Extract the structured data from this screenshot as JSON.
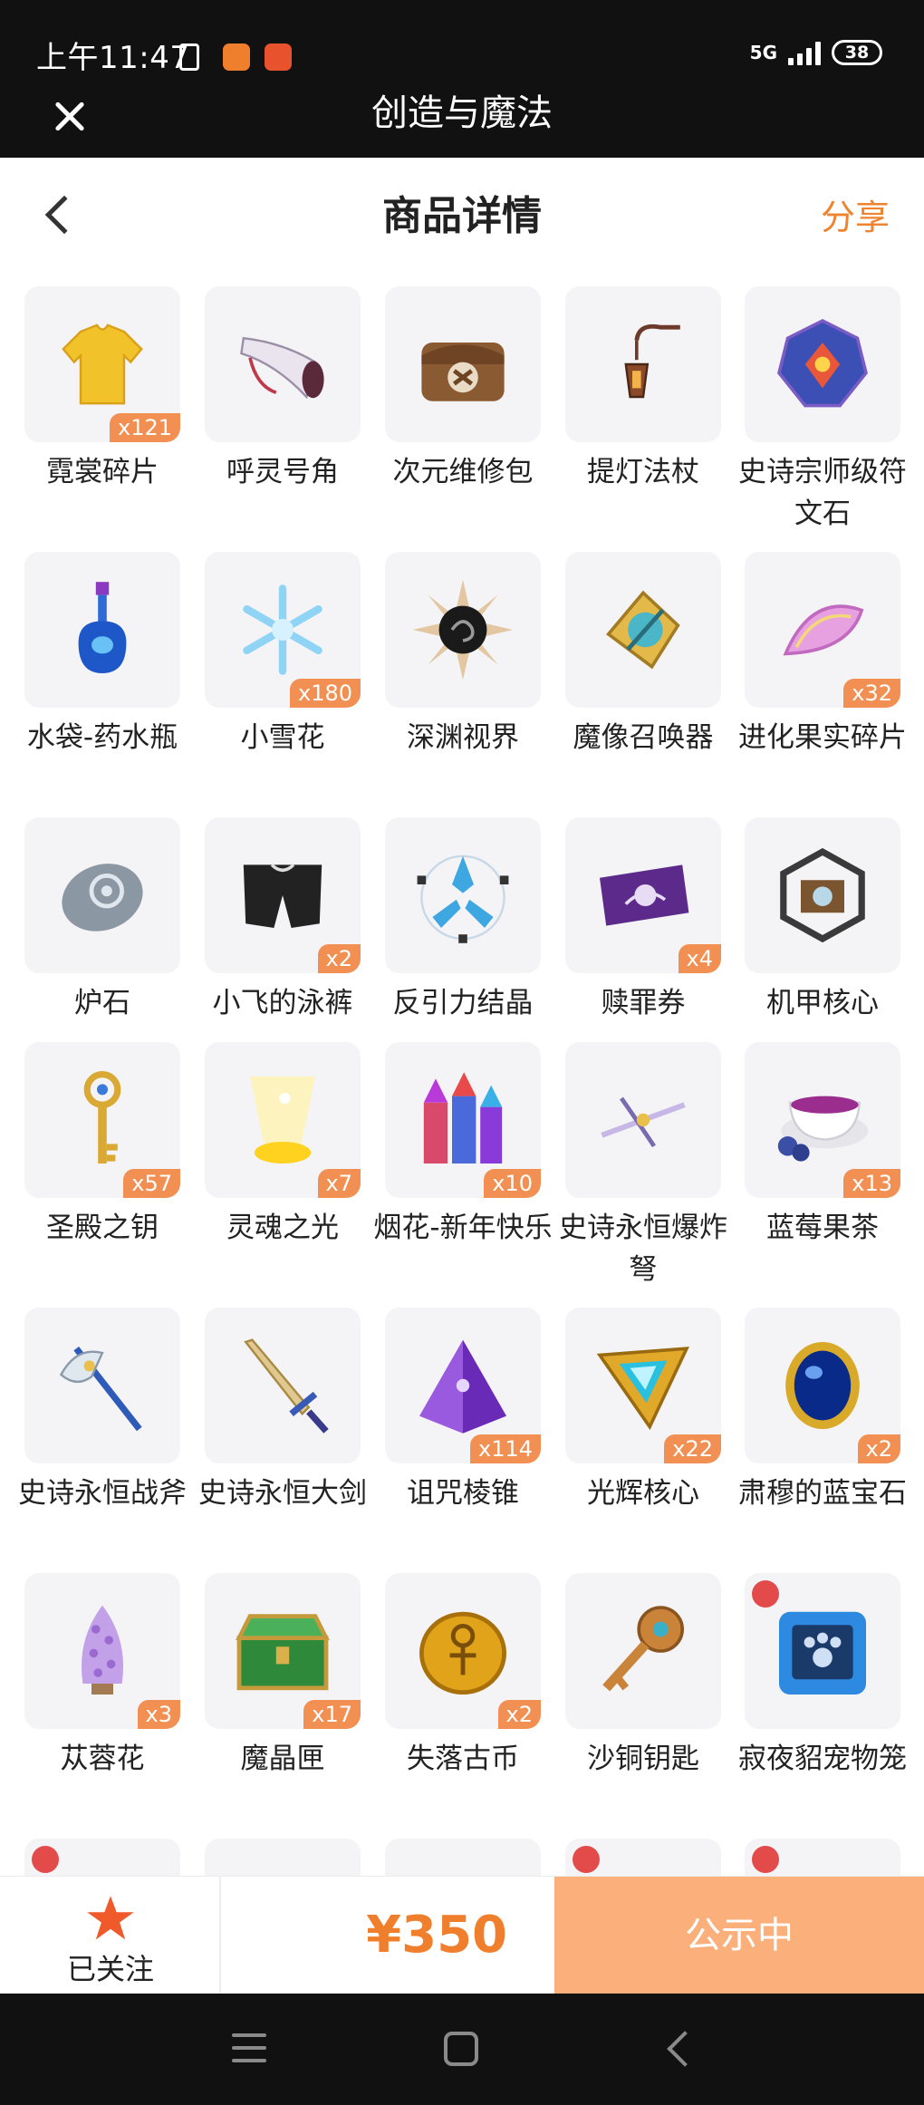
{
  "status_bar": {
    "time": "上午11:47",
    "network": "5G",
    "battery": "38"
  },
  "app_bar": {
    "title": "创造与魔法"
  },
  "header": {
    "title": "商品详情",
    "share_label": "分享"
  },
  "items": [
    {
      "name": "霓裳碎片",
      "count": "x121",
      "icon": "shirt-icon"
    },
    {
      "name": "呼灵号角",
      "count": "",
      "icon": "horn-icon"
    },
    {
      "name": "次元维修包",
      "count": "",
      "icon": "repair-bag-icon"
    },
    {
      "name": "提灯法杖",
      "count": "",
      "icon": "lantern-staff-icon"
    },
    {
      "name": "史诗宗师级符文石",
      "count": "",
      "icon": "rune-stone-icon"
    },
    {
      "name": "水袋-药水瓶",
      "count": "",
      "icon": "potion-bottle-icon"
    },
    {
      "name": "小雪花",
      "count": "x180",
      "icon": "snowflake-icon"
    },
    {
      "name": "深渊视界",
      "count": "",
      "icon": "abyss-sun-icon"
    },
    {
      "name": "魔像召唤器",
      "count": "",
      "icon": "golem-summoner-icon"
    },
    {
      "name": "进化果实碎片",
      "count": "x32",
      "icon": "fruit-slice-icon"
    },
    {
      "name": "炉石",
      "count": "",
      "icon": "hearthstone-icon"
    },
    {
      "name": "小飞的泳裤",
      "count": "x2",
      "icon": "swim-trunks-icon"
    },
    {
      "name": "反引力结晶",
      "count": "",
      "icon": "antigravity-crystal-icon"
    },
    {
      "name": "赎罪券",
      "count": "x4",
      "icon": "ticket-icon"
    },
    {
      "name": "机甲核心",
      "count": "",
      "icon": "mech-core-icon"
    },
    {
      "name": "圣殿之钥",
      "count": "x57",
      "icon": "key-icon"
    },
    {
      "name": "灵魂之光",
      "count": "x7",
      "icon": "soul-light-icon"
    },
    {
      "name": "烟花-新年快乐",
      "count": "x10",
      "icon": "firework-icon"
    },
    {
      "name": "史诗永恒爆炸弩",
      "count": "",
      "icon": "crossbow-icon"
    },
    {
      "name": "蓝莓果茶",
      "count": "x13",
      "icon": "tea-cup-icon"
    },
    {
      "name": "史诗永恒战斧",
      "count": "",
      "icon": "battle-axe-icon"
    },
    {
      "name": "史诗永恒大剑",
      "count": "",
      "icon": "greatsword-icon"
    },
    {
      "name": "诅咒棱锥",
      "count": "x114",
      "icon": "pyramid-icon"
    },
    {
      "name": "光辉核心",
      "count": "x22",
      "icon": "radiant-core-icon"
    },
    {
      "name": "肃穆的蓝宝石",
      "count": "x2",
      "icon": "sapphire-icon"
    },
    {
      "name": "苁蓉花",
      "count": "x3",
      "icon": "cistanche-flower-icon"
    },
    {
      "name": "魔晶匣",
      "count": "x17",
      "icon": "crystal-chest-icon"
    },
    {
      "name": "失落古币",
      "count": "x2",
      "icon": "ancient-coin-icon"
    },
    {
      "name": "沙铜钥匙",
      "count": "",
      "icon": "bronze-key-icon"
    },
    {
      "name": "寂夜貂宠物笼",
      "count": "",
      "icon": "pet-cage-icon"
    }
  ],
  "bottom_bar": {
    "follow_label": "已关注",
    "price": "¥350",
    "status_label": "公示中"
  },
  "colors": {
    "accent": "#ee8430",
    "badge": "#f28f52",
    "status_button": "#fbb07b",
    "dark_bar": "#111111"
  }
}
